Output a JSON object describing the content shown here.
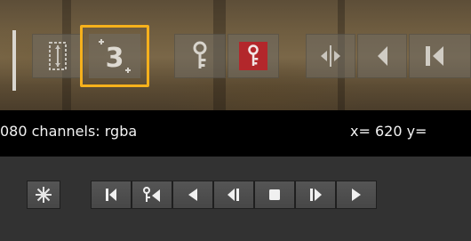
{
  "info_bar": {
    "channels_text": "080 channels: rgba",
    "coords_text": "x= 620 y="
  },
  "viewer_toolbar": {
    "frame_step_value": "3",
    "highlighted_button": "frame-step",
    "icons": [
      "ab-compare-icon",
      "frame-step-icon",
      "keyframe-icon",
      "keyframe-active-icon",
      "split-view-icon",
      "prev-icon",
      "prev-frame-icon"
    ]
  },
  "transport": {
    "icons": [
      "snowflake-icon",
      "skip-to-start-icon",
      "prev-keyframe-icon",
      "play-backward-icon",
      "step-back-icon",
      "stop-icon",
      "step-forward-icon",
      "play-forward-icon"
    ]
  },
  "colors": {
    "highlight": "#f6b11c",
    "keyframe_active": "#b3272b",
    "info_bar_bg": "#000000",
    "panel_bg": "#323232"
  }
}
